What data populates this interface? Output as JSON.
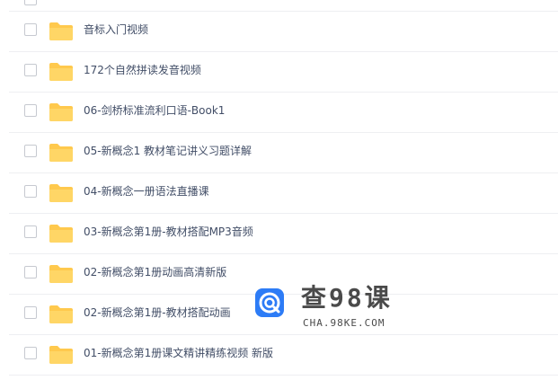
{
  "files": [
    {
      "name": "音标入门视频"
    },
    {
      "name": "172个自然拼读发音视频"
    },
    {
      "name": "06-剑桥标准流利口语-Book1"
    },
    {
      "name": "05-新概念1 教材笔记讲义习题详解"
    },
    {
      "name": "04-新概念一册语法直播课"
    },
    {
      "name": "03-新概念第1册-教材搭配MP3音频"
    },
    {
      "name": "02-新概念第1册动画高清新版"
    },
    {
      "name": "02-新概念第1册-教材搭配动画"
    },
    {
      "name": "01-新概念第1册课文精讲精练视频 新版"
    }
  ],
  "watermark": {
    "title": "查98课",
    "domain": "CHA.98KE.COM"
  },
  "colors": {
    "folder": "#ffc94d",
    "text": "#424e67",
    "divider": "#eeeff2",
    "watermark_blue": "#2d7cf6"
  }
}
